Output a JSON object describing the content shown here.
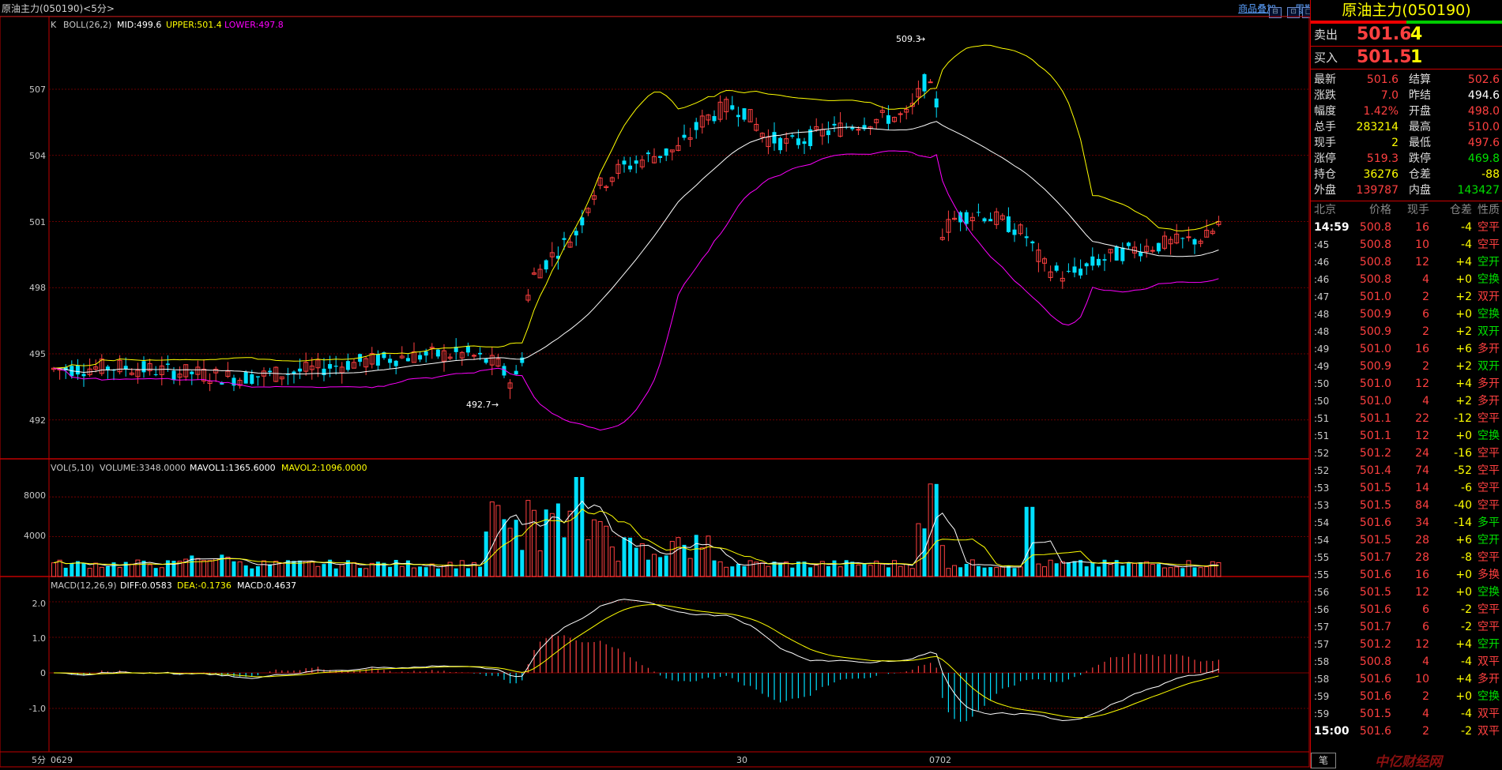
{
  "window": {
    "title": "原油主力(050190)<5分>",
    "links": [
      "商品叠加",
      "周期"
    ],
    "buttons": [
      "⊟",
      "⊡",
      "□"
    ]
  },
  "colors": {
    "up": "#ff4040",
    "down": "#00e0ff",
    "mid": "#ffffff",
    "upper": "#ffff00",
    "lower": "#ff00ff",
    "grid": "#8a0000",
    "axis": "#c00000"
  },
  "main": {
    "indicator": {
      "name": "K",
      "boll": "BOLL(26,2)",
      "mid": "MID:499.6",
      "upper": "UPPER:501.4",
      "lower": "LOWER:497.8"
    },
    "price_labels": [
      "507",
      "504",
      "501",
      "498",
      "495",
      "492"
    ],
    "high_annot": "509.3",
    "low_annot": "492.7"
  },
  "volume": {
    "label": "VOL(5,10)",
    "volume": "VOLUME:3348.0000",
    "mavol1": "MAVOL1:1365.6000",
    "mavol2": "MAVOL2:1096.0000",
    "labels": [
      "8000",
      "4000"
    ]
  },
  "macd": {
    "label": "MACD(12,26,9)",
    "diff": "DIFF:0.0583",
    "dea": "DEA:-0.1736",
    "macd": "MACD:0.4637",
    "labels": [
      "2.0",
      "1.0",
      "0",
      "-1.0"
    ]
  },
  "xaxis": {
    "period": "5分",
    "dates": [
      "0629",
      "30",
      "0702"
    ]
  },
  "chart_data": {
    "type": "candlestick",
    "title": "原油主力(050190) 5分",
    "ylim": [
      491,
      510.5
    ],
    "series_ohlc": [],
    "volume_ylim": [
      0,
      10000
    ],
    "macd_ylim": [
      -1.4,
      2.4
    ]
  },
  "panel": {
    "name": "原油主力(050190)",
    "ask": {
      "label": "卖出",
      "price": "501.6",
      "vol": "4"
    },
    "bid": {
      "label": "买入",
      "price": "501.5",
      "vol": "1"
    },
    "quote": [
      {
        "l1": "最新",
        "v1": "501.6",
        "c1": "red",
        "l2": "结算",
        "v2": "502.6",
        "c2": "red"
      },
      {
        "l1": "涨跌",
        "v1": "7.0",
        "c1": "red",
        "l2": "昨结",
        "v2": "494.6",
        "c2": "wht"
      },
      {
        "l1": "幅度",
        "v1": "1.42%",
        "c1": "red",
        "l2": "开盘",
        "v2": "498.0",
        "c2": "red"
      },
      {
        "l1": "总手",
        "v1": "283214",
        "c1": "yel",
        "l2": "最高",
        "v2": "510.0",
        "c2": "red"
      },
      {
        "l1": "现手",
        "v1": "2",
        "c1": "yel",
        "l2": "最低",
        "v2": "497.6",
        "c2": "red"
      },
      {
        "l1": "涨停",
        "v1": "519.3",
        "c1": "red",
        "l2": "跌停",
        "v2": "469.8",
        "c2": "grn"
      },
      {
        "l1": "持仓",
        "v1": "36276",
        "c1": "yel",
        "l2": "仓差",
        "v2": "-88",
        "c2": "yel"
      },
      {
        "l1": "外盘",
        "v1": "139787",
        "c1": "red",
        "l2": "内盘",
        "v2": "143427",
        "c2": "grn"
      }
    ],
    "ticks_head": [
      "北京",
      "价格",
      "现手",
      "仓差",
      "性质"
    ],
    "ticks": [
      {
        "t": "14:59",
        "p": "500.8",
        "v": "16",
        "o": "-4",
        "n": "空平",
        "oc": "yel",
        "nc": "red"
      },
      {
        "t": ":45",
        "p": "500.8",
        "v": "10",
        "o": "-4",
        "n": "空平",
        "oc": "yel",
        "nc": "red"
      },
      {
        "t": ":46",
        "p": "500.8",
        "v": "12",
        "o": "+4",
        "n": "空开",
        "oc": "yel",
        "nc": "grn"
      },
      {
        "t": ":46",
        "p": "500.8",
        "v": "4",
        "o": "+0",
        "n": "空换",
        "oc": "yel",
        "nc": "grn"
      },
      {
        "t": ":47",
        "p": "501.0",
        "v": "2",
        "o": "+2",
        "n": "双开",
        "oc": "yel",
        "nc": "red"
      },
      {
        "t": ":48",
        "p": "500.9",
        "v": "6",
        "o": "+0",
        "n": "空换",
        "oc": "yel",
        "nc": "grn"
      },
      {
        "t": ":48",
        "p": "500.9",
        "v": "2",
        "o": "+2",
        "n": "双开",
        "oc": "yel",
        "nc": "grn"
      },
      {
        "t": ":49",
        "p": "501.0",
        "v": "16",
        "o": "+6",
        "n": "多开",
        "oc": "yel",
        "nc": "red"
      },
      {
        "t": ":49",
        "p": "500.9",
        "v": "2",
        "o": "+2",
        "n": "双开",
        "oc": "yel",
        "nc": "grn"
      },
      {
        "t": ":50",
        "p": "501.0",
        "v": "12",
        "o": "+4",
        "n": "多开",
        "oc": "yel",
        "nc": "red"
      },
      {
        "t": ":50",
        "p": "501.0",
        "v": "4",
        "o": "+2",
        "n": "多开",
        "oc": "yel",
        "nc": "red"
      },
      {
        "t": ":51",
        "p": "501.1",
        "v": "22",
        "o": "-12",
        "n": "空平",
        "oc": "yel",
        "nc": "red"
      },
      {
        "t": ":51",
        "p": "501.1",
        "v": "12",
        "o": "+0",
        "n": "空换",
        "oc": "yel",
        "nc": "grn"
      },
      {
        "t": ":52",
        "p": "501.2",
        "v": "24",
        "o": "-16",
        "n": "空平",
        "oc": "yel",
        "nc": "red"
      },
      {
        "t": ":52",
        "p": "501.4",
        "v": "74",
        "o": "-52",
        "n": "空平",
        "oc": "yel",
        "nc": "red"
      },
      {
        "t": ":53",
        "p": "501.5",
        "v": "14",
        "o": "-6",
        "n": "空平",
        "oc": "yel",
        "nc": "red"
      },
      {
        "t": ":53",
        "p": "501.5",
        "v": "84",
        "o": "-40",
        "n": "空平",
        "oc": "yel",
        "nc": "red"
      },
      {
        "t": ":54",
        "p": "501.6",
        "v": "34",
        "o": "-14",
        "n": "多平",
        "oc": "yel",
        "nc": "grn"
      },
      {
        "t": ":54",
        "p": "501.5",
        "v": "28",
        "o": "+6",
        "n": "空开",
        "oc": "yel",
        "nc": "grn"
      },
      {
        "t": ":55",
        "p": "501.7",
        "v": "28",
        "o": "-8",
        "n": "空平",
        "oc": "yel",
        "nc": "red"
      },
      {
        "t": ":55",
        "p": "501.6",
        "v": "16",
        "o": "+0",
        "n": "多换",
        "oc": "yel",
        "nc": "red"
      },
      {
        "t": ":56",
        "p": "501.5",
        "v": "12",
        "o": "+0",
        "n": "空换",
        "oc": "yel",
        "nc": "grn"
      },
      {
        "t": ":56",
        "p": "501.6",
        "v": "6",
        "o": "-2",
        "n": "空平",
        "oc": "yel",
        "nc": "red"
      },
      {
        "t": ":57",
        "p": "501.7",
        "v": "6",
        "o": "-2",
        "n": "空平",
        "oc": "yel",
        "nc": "red"
      },
      {
        "t": ":57",
        "p": "501.2",
        "v": "12",
        "o": "+4",
        "n": "空开",
        "oc": "yel",
        "nc": "grn"
      },
      {
        "t": ":58",
        "p": "500.8",
        "v": "4",
        "o": "-4",
        "n": "双平",
        "oc": "yel",
        "nc": "red"
      },
      {
        "t": ":58",
        "p": "501.6",
        "v": "10",
        "o": "+4",
        "n": "多开",
        "oc": "yel",
        "nc": "red"
      },
      {
        "t": ":59",
        "p": "501.6",
        "v": "2",
        "o": "+0",
        "n": "空换",
        "oc": "yel",
        "nc": "grn"
      },
      {
        "t": ":59",
        "p": "501.5",
        "v": "4",
        "o": "-4",
        "n": "双平",
        "oc": "yel",
        "nc": "red"
      },
      {
        "t": "15:00",
        "p": "501.6",
        "v": "2",
        "o": "-2",
        "n": "双平",
        "oc": "yel",
        "nc": "red"
      }
    ],
    "tab": "笔"
  },
  "watermark": "中亿财经网"
}
